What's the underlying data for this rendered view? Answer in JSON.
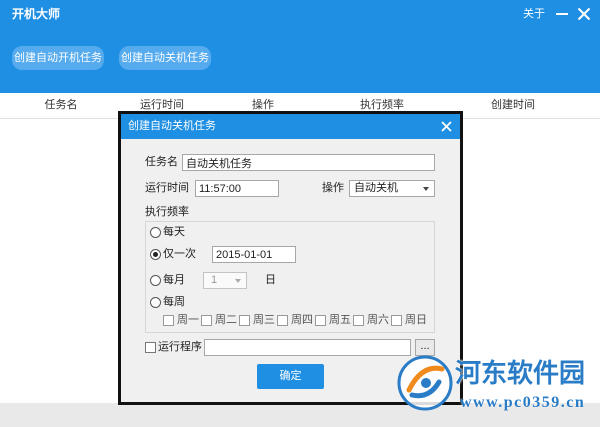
{
  "window": {
    "title": "开机大师",
    "about_label": "关于"
  },
  "toolbar": {
    "buttons": [
      {
        "label": "创建自动开机任务"
      },
      {
        "label": "创建自动关机任务"
      }
    ]
  },
  "task_table": {
    "columns": [
      "任务名",
      "运行时间",
      "操作",
      "执行频率",
      "创建时间"
    ],
    "rows": []
  },
  "dialog": {
    "title": "创建自动关机任务",
    "task_name": {
      "label": "任务名",
      "value": "自动关机任务"
    },
    "run_time": {
      "label": "运行时间",
      "value": "11:57:00"
    },
    "action": {
      "label": "操作",
      "value": "自动关机"
    },
    "frequency": {
      "label": "执行频率",
      "options": [
        {
          "label": "每天",
          "checked": false
        },
        {
          "label": "仅一次",
          "checked": true,
          "date": "2015-01-01"
        },
        {
          "label": "每月",
          "checked": false,
          "day": "1",
          "day_suffix": "日",
          "day_select_disabled": true
        },
        {
          "label": "每周",
          "checked": false
        }
      ],
      "weekdays_disabled": true,
      "weekdays": [
        {
          "label": "周一",
          "checked": false
        },
        {
          "label": "周二",
          "checked": false
        },
        {
          "label": "周三",
          "checked": false
        },
        {
          "label": "周四",
          "checked": false
        },
        {
          "label": "周五",
          "checked": false
        },
        {
          "label": "周六",
          "checked": false
        },
        {
          "label": "周日",
          "checked": false
        }
      ]
    },
    "run_program": {
      "label": "运行程序",
      "checked": false,
      "path": "",
      "browse_label": "..."
    },
    "confirm_label": "确定"
  },
  "watermark": {
    "name": "河东软件园",
    "url": "www.pc0359.cn"
  },
  "icons": {
    "minimize": "minimize-icon",
    "window_close": "close-icon",
    "dialog_close": "close-icon",
    "dropdown": "chevron-down-icon",
    "watermark_logo": "logo-icon"
  },
  "colors": {
    "accent": "#1f8fe4",
    "accent-light": "#55abee",
    "dialog-bg": "#f0f0f0",
    "dialog-border": "#111111",
    "footer-bg": "#e9e9e9",
    "watermark-blue": "#2a7cc7",
    "watermark-orange": "#f08a1c"
  }
}
